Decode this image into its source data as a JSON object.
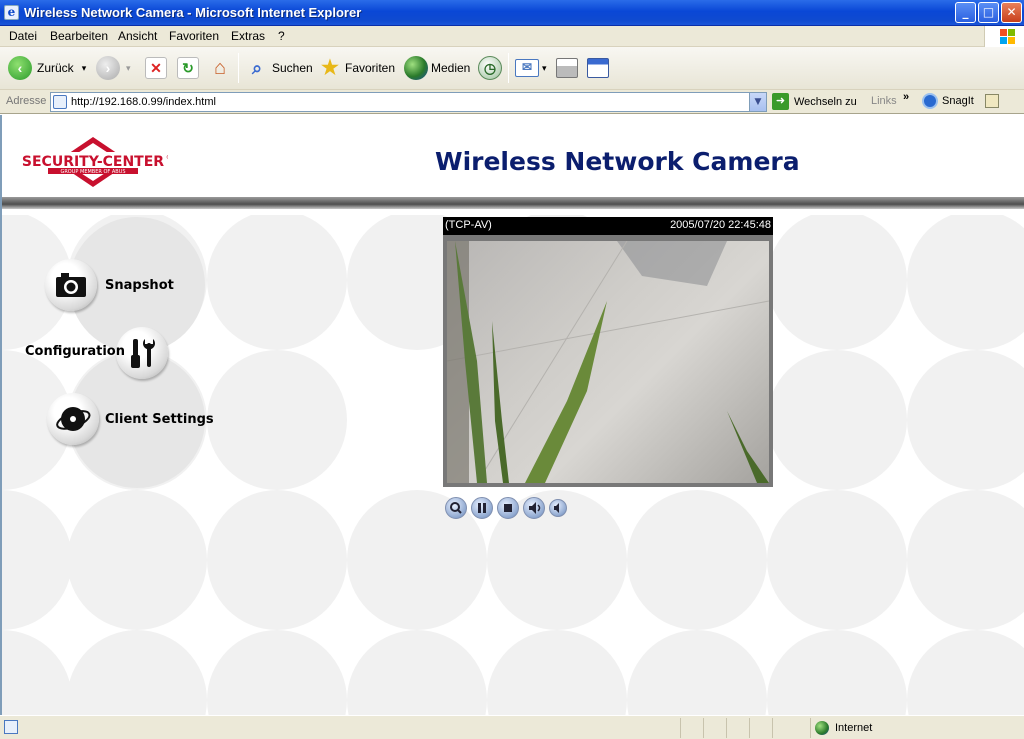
{
  "window": {
    "title": "Wireless Network Camera - Microsoft Internet Explorer",
    "minimize": "_",
    "maximize": "□",
    "close": "✕"
  },
  "menu": {
    "items": [
      "Datei",
      "Bearbeiten",
      "Ansicht",
      "Favoriten",
      "Extras",
      "?"
    ]
  },
  "toolbar": {
    "back_label": "Zurück",
    "search_label": "Suchen",
    "favorites_label": "Favoriten",
    "media_label": "Medien",
    "dropdown_glyph": "▾"
  },
  "address": {
    "label": "Adresse",
    "url": "http://192.168.0.99/index.html",
    "go_label": "Wechseln zu",
    "links_label": "Links",
    "links_chevron": "»",
    "snagit_label": "SnagIt"
  },
  "page": {
    "logo_text": "SECURITY-CENTER",
    "logo_sub": "GROUP MEMBER OF ABUS",
    "logo_reg": "®",
    "title": "Wireless Network Camera",
    "nav": {
      "snapshot": "Snapshot",
      "configuration": "Configuration",
      "client_settings": "Client Settings"
    },
    "video": {
      "mode": "(TCP-AV)",
      "timestamp": "2005/07/20 22:45:48"
    }
  },
  "status": {
    "zone": "Internet"
  },
  "colors": {
    "title_blue": "#0b1e6e",
    "logo_red": "#c8102e",
    "xp_blue": "#0a47d6"
  }
}
